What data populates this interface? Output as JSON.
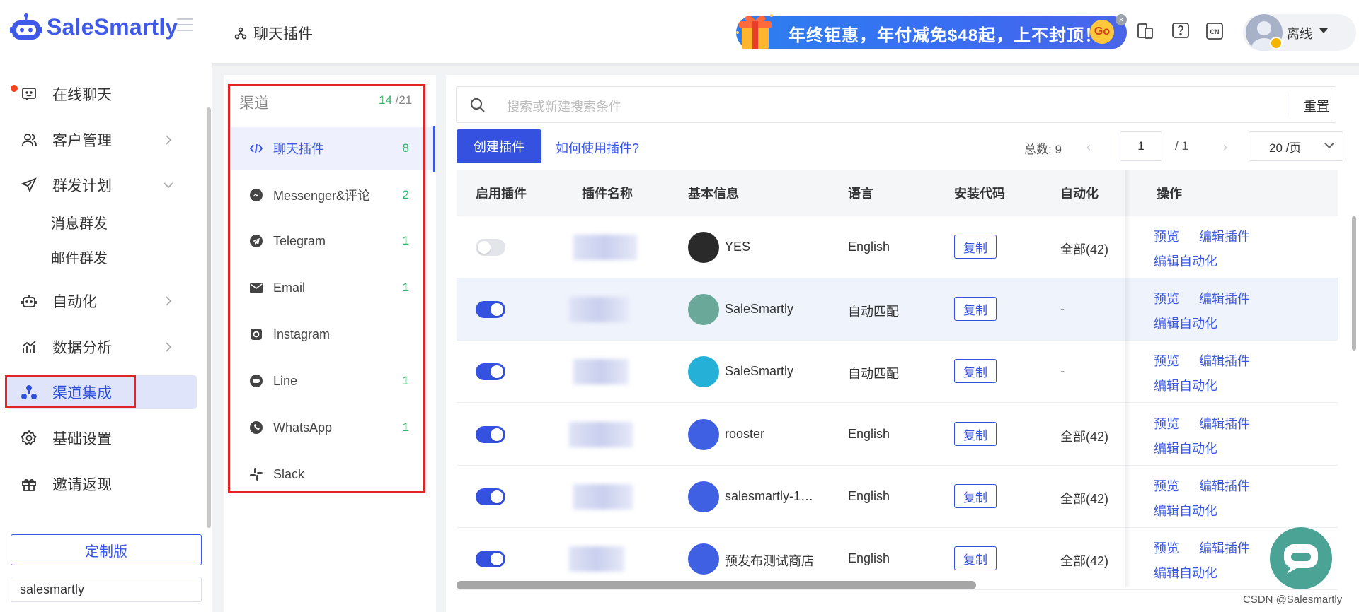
{
  "brand": {
    "name": "SaleSmartly",
    "color": "#3f5ae8"
  },
  "nav": {
    "items": [
      {
        "label": "在线聊天",
        "icon": "chat-icon"
      },
      {
        "label": "客户管理",
        "icon": "users-icon"
      },
      {
        "label": "群发计划",
        "icon": "send-icon"
      },
      {
        "label": "自动化",
        "icon": "robot-icon"
      },
      {
        "label": "数据分析",
        "icon": "analytics-icon"
      },
      {
        "label": "渠道集成",
        "icon": "integration-icon"
      },
      {
        "label": "基础设置",
        "icon": "gear-icon"
      },
      {
        "label": "邀请返现",
        "icon": "gift-icon"
      }
    ],
    "sub_items": [
      "消息群发",
      "邮件群发"
    ],
    "custom_button": "定制版",
    "account": "salesmartly"
  },
  "header": {
    "breadcrumb": "聊天插件",
    "banner_text": "年终钜惠，年付减免$48起，上不封顶！",
    "banner_go": "Go",
    "status": "离线"
  },
  "channels": {
    "title": "渠道",
    "count_active": "14",
    "count_total": "/21",
    "items": [
      {
        "label": "聊天插件",
        "count": "8",
        "icon": "code-icon"
      },
      {
        "label": "Messenger&评论",
        "count": "2",
        "icon": "messenger-icon"
      },
      {
        "label": "Telegram",
        "count": "1",
        "icon": "telegram-icon"
      },
      {
        "label": "Email",
        "count": "1",
        "icon": "email-icon"
      },
      {
        "label": "Instagram",
        "count": "",
        "icon": "instagram-icon"
      },
      {
        "label": "Line",
        "count": "1",
        "icon": "line-icon"
      },
      {
        "label": "WhatsApp",
        "count": "1",
        "icon": "whatsapp-icon"
      },
      {
        "label": "Slack",
        "count": "",
        "icon": "slack-icon"
      }
    ]
  },
  "toolbar": {
    "search_placeholder": "搜索或新建搜索条件",
    "reset": "重置",
    "create": "创建插件",
    "howto": "如何使用插件?",
    "total": "总数:  9",
    "page_current": "1",
    "page_of": "/  1",
    "page_size": "20 /页"
  },
  "table": {
    "columns": [
      "启用插件",
      "插件名称",
      "基本信息",
      "语言",
      "安装代码",
      "自动化",
      "操作"
    ],
    "rows": [
      {
        "enabled": false,
        "info": "YES",
        "language": "English",
        "copy": "复制",
        "automation": "全部(42)",
        "avatar": "#2a2a2a"
      },
      {
        "enabled": true,
        "info": "SaleSmartly",
        "language": "自动匹配",
        "copy": "复制",
        "automation": "-",
        "avatar": "#6aa89a"
      },
      {
        "enabled": true,
        "info": "SaleSmartly",
        "language": "自动匹配",
        "copy": "复制",
        "automation": "-",
        "avatar": "#25b0d8"
      },
      {
        "enabled": true,
        "info": "rooster",
        "language": "English",
        "copy": "复制",
        "automation": "全部(42)",
        "avatar": "#3f60e3"
      },
      {
        "enabled": true,
        "info": "salesmartly-1…",
        "language": "English",
        "copy": "复制",
        "automation": "全部(42)",
        "avatar": "#3f60e3"
      },
      {
        "enabled": true,
        "info": "预发布测试商店",
        "language": "English",
        "copy": "复制",
        "automation": "全部(42)",
        "avatar": "#3f60e3"
      }
    ],
    "ops": {
      "preview": "预览",
      "edit_plugin": "编辑插件",
      "edit_automation": "编辑自动化"
    }
  },
  "watermark": "CSDN @Salesmartly"
}
